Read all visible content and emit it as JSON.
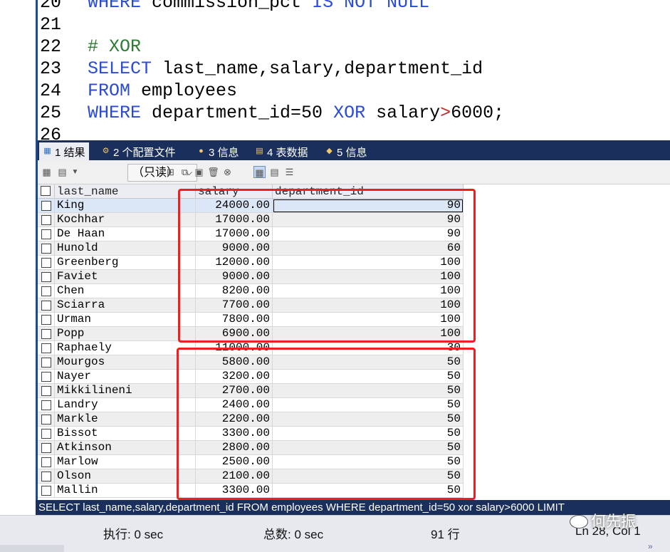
{
  "editor": {
    "lines": [
      {
        "n": "20",
        "parts": [
          {
            "t": "WHERE ",
            "c": "kw"
          },
          {
            "t": "commission_pct ",
            "c": ""
          },
          {
            "t": "IS NOT NULL",
            "c": "kw"
          }
        ]
      },
      {
        "n": "21",
        "parts": []
      },
      {
        "n": "22",
        "parts": [
          {
            "t": "# XOR",
            "c": "cm"
          }
        ]
      },
      {
        "n": "23",
        "parts": [
          {
            "t": "SELECT ",
            "c": "kw"
          },
          {
            "t": "last_name,salary,department_id",
            "c": ""
          }
        ]
      },
      {
        "n": "24",
        "parts": [
          {
            "t": "FROM ",
            "c": "kw"
          },
          {
            "t": "employees",
            "c": ""
          }
        ]
      },
      {
        "n": "25",
        "parts": [
          {
            "t": "WHERE ",
            "c": "kw"
          },
          {
            "t": "department_id=50 ",
            "c": ""
          },
          {
            "t": "XOR ",
            "c": "kw"
          },
          {
            "t": "salary",
            "c": ""
          },
          {
            "t": ">",
            "c": "op"
          },
          {
            "t": "6000;",
            "c": ""
          }
        ]
      },
      {
        "n": "26",
        "parts": []
      }
    ]
  },
  "tabs": [
    {
      "label": "1 结果",
      "icon": "result-grid-icon",
      "active": true
    },
    {
      "label": "2 个配置文件",
      "icon": "profile-icon",
      "active": false
    },
    {
      "label": "3 信息",
      "icon": "info-icon",
      "active": false
    },
    {
      "label": "4 表数据",
      "icon": "table-data-icon",
      "active": false
    },
    {
      "label": "5 信息",
      "icon": "info-color-icon",
      "active": false
    }
  ],
  "toolbar": {
    "mode": "（只读）"
  },
  "grid": {
    "columns": [
      "last_name",
      "salary",
      "department_id"
    ],
    "rows": [
      [
        "King",
        "24000.00",
        "90"
      ],
      [
        "Kochhar",
        "17000.00",
        "90"
      ],
      [
        "De Haan",
        "17000.00",
        "90"
      ],
      [
        "Hunold",
        "9000.00",
        "60"
      ],
      [
        "Greenberg",
        "12000.00",
        "100"
      ],
      [
        "Faviet",
        "9000.00",
        "100"
      ],
      [
        "Chen",
        "8200.00",
        "100"
      ],
      [
        "Sciarra",
        "7700.00",
        "100"
      ],
      [
        "Urman",
        "7800.00",
        "100"
      ],
      [
        "Popp",
        "6900.00",
        "100"
      ],
      [
        "Raphaely",
        "11000.00",
        "30"
      ],
      [
        "Mourgos",
        "5800.00",
        "50"
      ],
      [
        "Nayer",
        "3200.00",
        "50"
      ],
      [
        "Mikkilineni",
        "2700.00",
        "50"
      ],
      [
        "Landry",
        "2400.00",
        "50"
      ],
      [
        "Markle",
        "2200.00",
        "50"
      ],
      [
        "Bissot",
        "3300.00",
        "50"
      ],
      [
        "Atkinson",
        "2800.00",
        "50"
      ],
      [
        "Marlow",
        "2500.00",
        "50"
      ],
      [
        "Olson",
        "2100.00",
        "50"
      ],
      [
        "Mallin",
        "3300.00",
        "50"
      ]
    ]
  },
  "sqlbar": "SELECT last_name,salary,department_id FROM employees WHERE department_id=50 xor salary>6000 LIMIT",
  "status": {
    "exec": "执行: 0 sec",
    "total": "总数: 0 sec",
    "rows": "91 行",
    "pos": "Ln 28, Col 1"
  },
  "watermark": "何先振"
}
